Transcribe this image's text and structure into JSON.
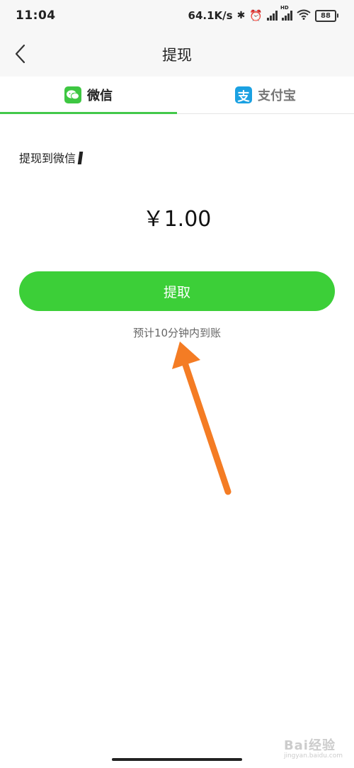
{
  "status_bar": {
    "time": "11:04",
    "net_speed": "64.1K/s",
    "hd_label": "HD",
    "battery": "88"
  },
  "header": {
    "title": "提现",
    "back_icon": "chevron-left-icon"
  },
  "tabs": [
    {
      "label": "微信",
      "icon": "wechat-icon",
      "active": true
    },
    {
      "label": "支付宝",
      "icon": "alipay-icon",
      "active": false
    }
  ],
  "form": {
    "target_label": "提现到微信",
    "amount": "￥1.00",
    "submit_label": "提取",
    "hint": "预计10分钟内到账"
  },
  "watermark": {
    "text": "Bai经验",
    "sub": "jingyan.baidu.com"
  },
  "colors": {
    "accent_green": "#3ccf38",
    "tab_underline": "#43c94a",
    "alipay_blue": "#1ba1e2",
    "arrow_orange": "#f47c24"
  }
}
